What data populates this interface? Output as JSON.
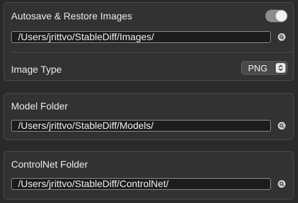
{
  "autosave": {
    "label": "Autosave & Restore Images",
    "enabled": true,
    "path": "/Users/jrittvo/StableDiff/Images/",
    "icon": "search-icon"
  },
  "image_type": {
    "label": "Image Type",
    "value": "PNG",
    "icon": "up-down-chevron-icon"
  },
  "model_folder": {
    "label": "Model Folder",
    "path": "/Users/jrittvo/StableDiff/Models/",
    "icon": "search-icon"
  },
  "controlnet_folder": {
    "label": "ControlNet Folder",
    "path": "/Users/jrittvo/StableDiff/ControlNet/",
    "icon": "search-icon"
  },
  "colors": {
    "background": "#2a2a2a",
    "panel": "#323232",
    "field": "#1c1c1c",
    "toggle_on": "#8c8c8c"
  }
}
